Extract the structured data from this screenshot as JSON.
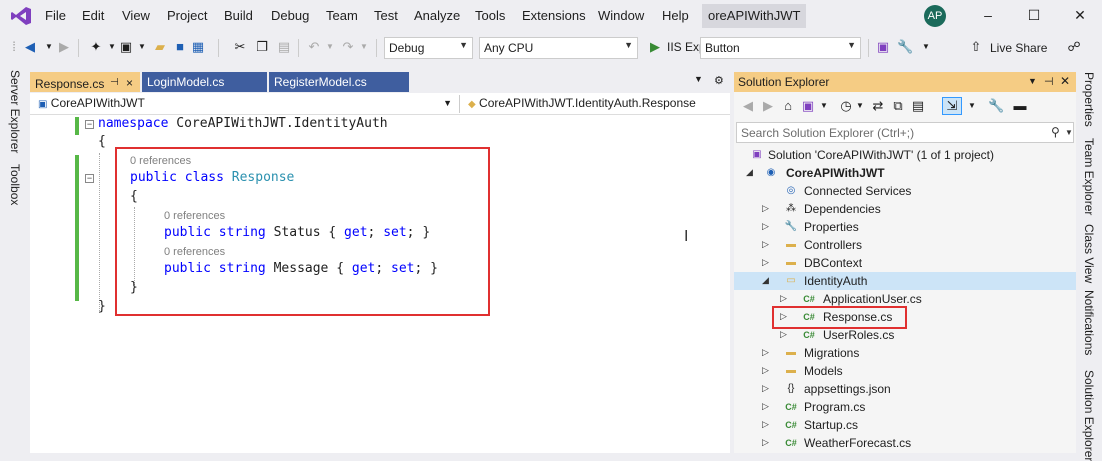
{
  "window": {
    "title": "oreAPIWithJWT",
    "avatar_initials": "AP",
    "menu": [
      "File",
      "Edit",
      "View",
      "Project",
      "Build",
      "Debug",
      "Team",
      "Test",
      "Analyze",
      "Tools",
      "Extensions",
      "Window",
      "Help"
    ]
  },
  "toolbar": {
    "config": "Debug",
    "platform": "Any CPU",
    "run_label": "IIS Exp",
    "run_target": "Button",
    "live_share": "Live Share"
  },
  "left_rail": {
    "server_explorer": "Server Explorer",
    "toolbox": "Toolbox"
  },
  "right_rail": {
    "properties": "Properties",
    "team_explorer": "Team Explorer",
    "class_view": "Class View",
    "notifications": "Notifications",
    "solution_explorer": "Solution Explorer"
  },
  "tabs": [
    {
      "label": "Response.cs",
      "pin": "⊣",
      "close": "×"
    },
    {
      "label": "LoginModel.cs"
    },
    {
      "label": "RegisterModel.cs"
    }
  ],
  "nav": {
    "project": "CoreAPIWithJWT",
    "type": "CoreAPIWithJWT.IdentityAuth.Response"
  },
  "code": {
    "ns_kw": "namespace",
    "ns_name": " CoreAPIWithJWT.IdentityAuth",
    "open_brace": "{",
    "close_brace": "}",
    "refs": "0 references",
    "public_kw": "public",
    "class_kw": "class",
    "class_name": "Response",
    "string_kw": "string",
    "get_kw": "get",
    "set_kw": "set",
    "prop1": "Status",
    "prop2": "Message"
  },
  "solution_explorer": {
    "title": "Solution Explorer",
    "search_placeholder": "Search Solution Explorer (Ctrl+;)",
    "items": [
      {
        "label": "Solution 'CoreAPIWithJWT' (1 of 1 project)",
        "icon": "solution-icon"
      },
      {
        "label": "CoreAPIWithJWT",
        "icon": "web-project-icon"
      },
      {
        "label": "Connected Services",
        "icon": "connected-services-icon"
      },
      {
        "label": "Dependencies",
        "icon": "dependencies-icon"
      },
      {
        "label": "Properties",
        "icon": "properties-icon"
      },
      {
        "label": "Controllers",
        "icon": "folder-icon"
      },
      {
        "label": "DBContext",
        "icon": "folder-icon"
      },
      {
        "label": "IdentityAuth",
        "icon": "folder-open-icon"
      },
      {
        "label": "ApplicationUser.cs",
        "icon": "csharp-file-icon"
      },
      {
        "label": "Response.cs",
        "icon": "csharp-file-icon"
      },
      {
        "label": "UserRoles.cs",
        "icon": "csharp-file-icon"
      },
      {
        "label": "Migrations",
        "icon": "folder-icon"
      },
      {
        "label": "Models",
        "icon": "folder-icon"
      },
      {
        "label": "appsettings.json",
        "icon": "json-file-icon"
      },
      {
        "label": "Program.cs",
        "icon": "csharp-file-icon"
      },
      {
        "label": "Startup.cs",
        "icon": "csharp-file-icon"
      },
      {
        "label": "WeatherForecast.cs",
        "icon": "csharp-file-icon"
      }
    ]
  }
}
